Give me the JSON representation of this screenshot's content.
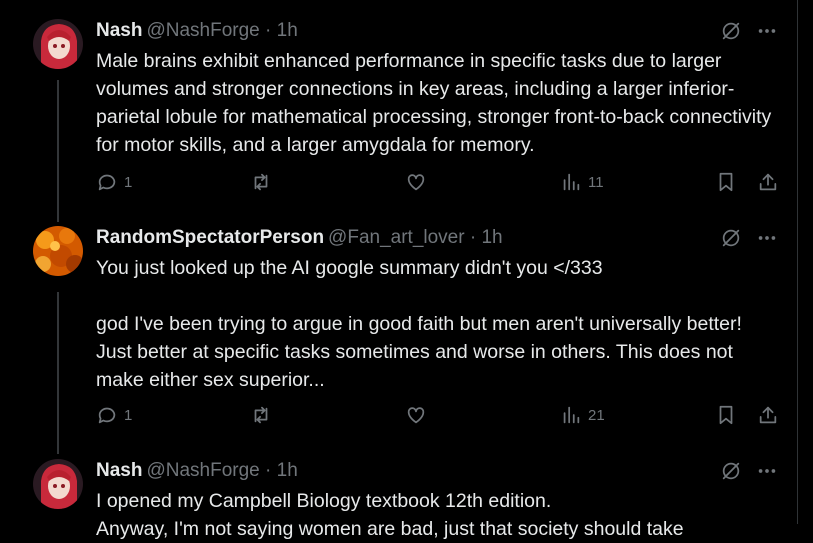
{
  "posts": [
    {
      "name": "Nash",
      "handle": "@NashForge · 1h",
      "text": "Male brains exhibit enhanced performance in specific tasks due to larger volumes and stronger connections in key areas, including a larger inferior-parietal lobule for mathematical processing, stronger front-to-back connectivity for motor skills, and a larger amygdala for memory.",
      "replies": "1",
      "reposts": "",
      "likes": "",
      "views": "11"
    },
    {
      "name": "RandomSpectatorPerson",
      "handle": "@Fan_art_lover · 1h",
      "text": "You just looked up the AI google summary didn't you </333\n\ngod I've been trying to argue in good faith but men aren't universally better! Just better at specific tasks sometimes and worse in others. This does not make either sex superior...",
      "replies": "1",
      "reposts": "",
      "likes": "",
      "views": "21"
    },
    {
      "name": "Nash",
      "handle": "@NashForge · 1h",
      "text": "I opened my Campbell Biology textbook 12th edition.\nAnyway, I'm not saying women are bad, just that society should take"
    }
  ],
  "colors": {
    "background": "#000000",
    "text": "#e7e9ea",
    "muted": "#71767b",
    "thread_line": "#333639"
  },
  "icons": [
    "grok-icon",
    "more-icon",
    "reply-icon",
    "repost-icon",
    "like-icon",
    "views-icon",
    "bookmark-icon",
    "share-icon"
  ]
}
